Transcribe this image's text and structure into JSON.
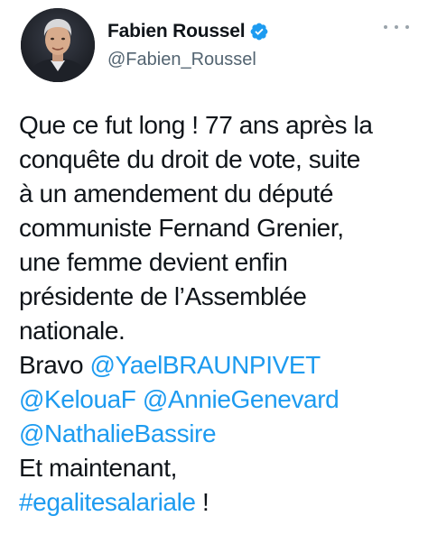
{
  "author": {
    "display_name": "Fabien Roussel",
    "handle": "@Fabien_Roussel",
    "verified": true,
    "avatar_icon": "profile-photo"
  },
  "colors": {
    "link": "#1d9bf0",
    "text": "#0f1419",
    "muted": "#536471",
    "verified": "#1d9bf0"
  },
  "tweet": {
    "lines": [
      "Que ce fut long ! 77 ans après la",
      "conquête du droit de vote, suite",
      "à un amendement du député",
      "communiste Fernand Grenier,",
      "une femme devient enfin",
      "présidente de l’Assemblée",
      "nationale."
    ],
    "bravo_label": "Bravo ",
    "mentions": [
      "@YaelBRAUNPIVET",
      "@KelouaF",
      "@AnnieGenevard",
      "@NathalieBassire"
    ],
    "closing": "Et maintenant,",
    "hashtag": "#egalitesalariale",
    "hashtag_suffix": " !"
  }
}
